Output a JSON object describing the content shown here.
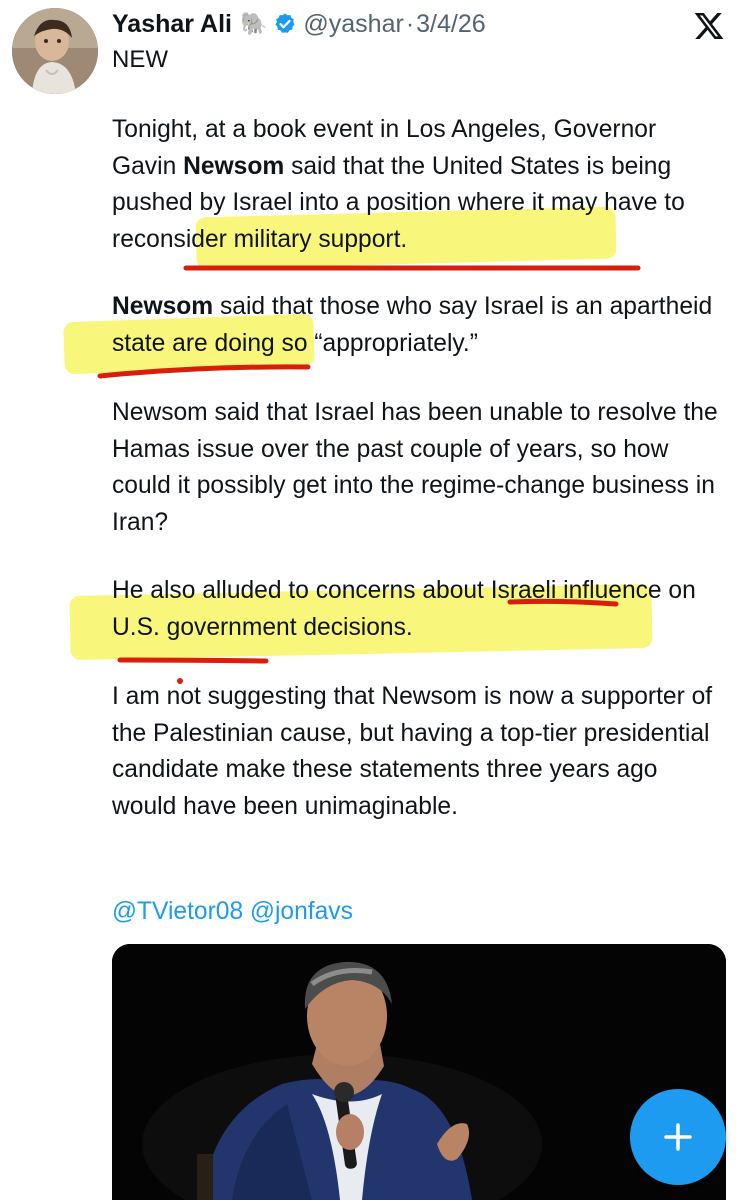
{
  "tweet": {
    "author_name": "Yashar Ali",
    "author_emoji": "🐘",
    "handle": "@yashar",
    "separator": "·",
    "date": "3/4/26",
    "label": "NEW",
    "p1": {
      "a": "Tonight, at a book event in Los Angeles, Governor Gavin ",
      "bold": "Newsom",
      "b": " said that the United States is being pushed by Israel into a position where it may have to reconsider military support."
    },
    "p2": {
      "bold": "Newsom",
      "b": " said that those who say Israel is an apartheid state are doing so “appropriately.”"
    },
    "p3": "Newsom said that Israel has been unable to resolve the Hamas issue over the past couple of years, so how could it possibly get into the regime-change business in Iran?",
    "p4": "He also alluded to concerns about Israeli influence on U.S. government decisions.",
    "p5": "I am not suggesting that Newsom is now a supporter of the Palestinian cause, but having a top-tier presidential candidate make these statements three years ago would have been unimaginable.",
    "mentions": [
      "@TVietor08",
      "@jonfavs"
    ]
  },
  "icons": {
    "verified": "verified-badge-icon",
    "x_logo": "x-logo-icon",
    "compose": "plus-icon"
  },
  "colors": {
    "link": "#1d9bf0",
    "secondary_text": "#536471",
    "highlight": "#f9f56a",
    "underline": "#d91e0b",
    "fab": "#1d9bf0"
  }
}
